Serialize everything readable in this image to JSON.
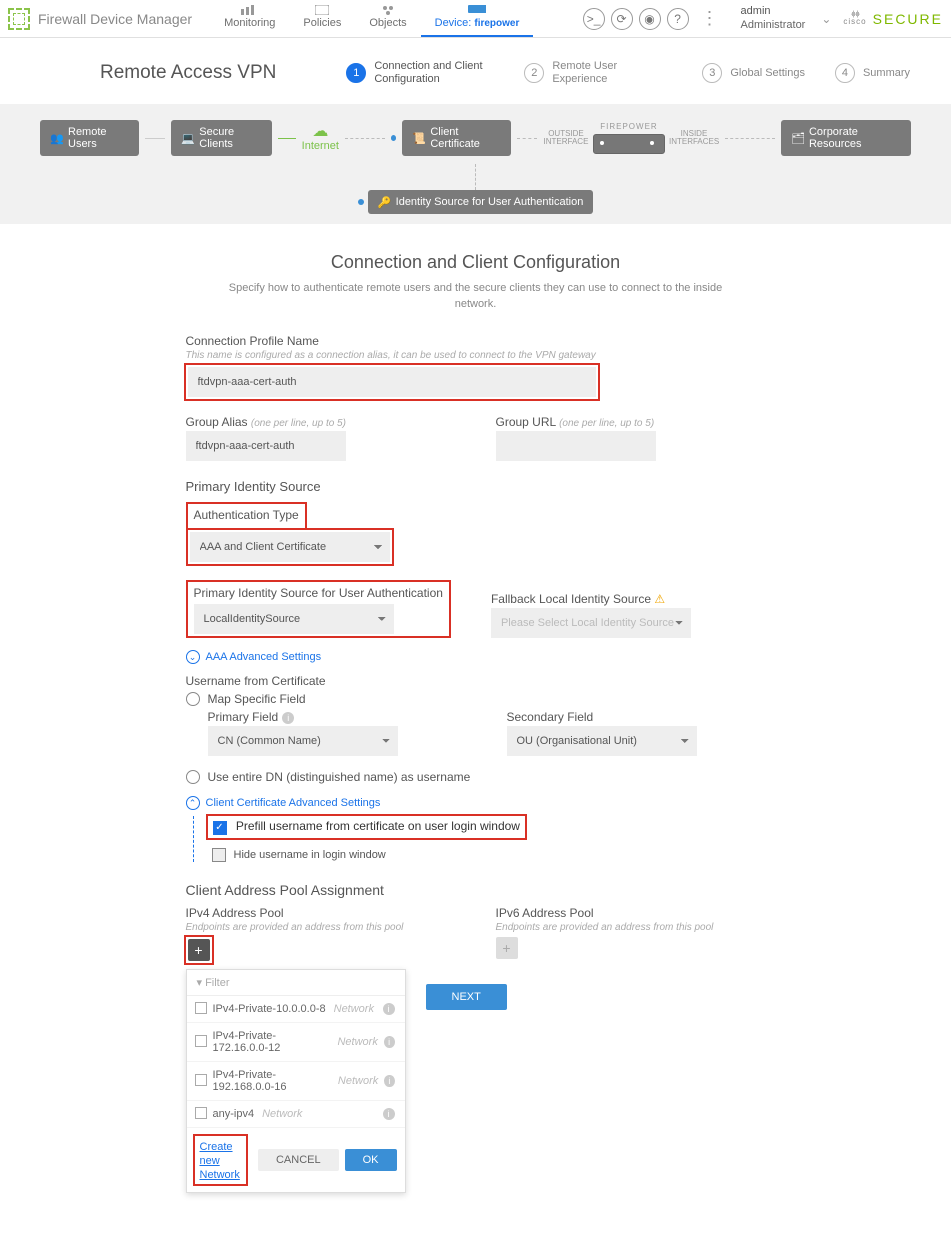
{
  "app": {
    "title": "Firewall Device Manager"
  },
  "nav": {
    "monitoring": "Monitoring",
    "policies": "Policies",
    "objects": "Objects",
    "device_label": "Device:",
    "device_name": "firepower"
  },
  "user": {
    "name": "admin",
    "role": "Administrator"
  },
  "brand": {
    "cisco": "cisco",
    "secure": "SECURE"
  },
  "page": {
    "title": "Remote Access VPN"
  },
  "steps": {
    "s1": "Connection and Client Configuration",
    "s2": "Remote User Experience",
    "s3": "Global Settings",
    "s4": "Summary"
  },
  "topo": {
    "remote_users": "Remote Users",
    "secure_clients": "Secure Clients",
    "internet": "Internet",
    "client_cert": "Client Certificate",
    "outside": "OUTSIDE INTERFACE",
    "inside": "INSIDE INTERFACES",
    "firepower": "FIREPOWER",
    "corp": "Corporate Resources",
    "id_source": "Identity Source for User Authentication"
  },
  "form": {
    "heading": "Connection and Client Configuration",
    "desc": "Specify how to authenticate remote users and the secure clients they can use to connect to the inside network.",
    "profile_label": "Connection Profile Name",
    "profile_hint": "This name is configured as a connection alias, it can be used to connect to the VPN gateway",
    "profile_value": "ftdvpn-aaa-cert-auth",
    "alias_label": "Group Alias",
    "alias_hint": "(one per line, up to 5)",
    "alias_value": "ftdvpn-aaa-cert-auth",
    "url_label": "Group URL",
    "url_hint": "(one per line, up to 5)",
    "primary_hdr": "Primary Identity Source",
    "auth_type_label": "Authentication Type",
    "auth_type_value": "AAA and Client Certificate",
    "pisrc_label": "Primary Identity Source for User Authentication",
    "pisrc_value": "LocalIdentitySource",
    "fallback_label": "Fallback Local Identity Source",
    "fallback_placeholder": "Please Select Local Identity Source",
    "aaa_adv": "AAA Advanced Settings",
    "uname_cert": "Username from Certificate",
    "map_field": "Map Specific Field",
    "primary_field": "Primary Field",
    "primary_field_value": "CN (Common Name)",
    "secondary_field": "Secondary Field",
    "secondary_field_value": "OU (Organisational Unit)",
    "use_dn": "Use entire DN (distinguished name) as username",
    "cert_adv": "Client Certificate Advanced Settings",
    "prefill": "Prefill username from certificate on user login window",
    "hide_user": "Hide username in login window",
    "pool_hdr": "Client Address Pool Assignment",
    "ipv4_label": "IPv4 Address Pool",
    "ipv6_label": "IPv6 Address Pool",
    "pool_hint": "Endpoints are provided an address from this pool",
    "filter": "Filter",
    "networks": [
      {
        "name": "IPv4-Private-10.0.0.0-8",
        "type": "Network"
      },
      {
        "name": "IPv4-Private-172.16.0.0-12",
        "type": "Network"
      },
      {
        "name": "IPv4-Private-192.168.0.0-16",
        "type": "Network"
      },
      {
        "name": "any-ipv4",
        "type": "Network"
      }
    ],
    "create_net": "Create new Network",
    "cancel": "CANCEL",
    "ok": "OK",
    "next": "NEXT"
  }
}
